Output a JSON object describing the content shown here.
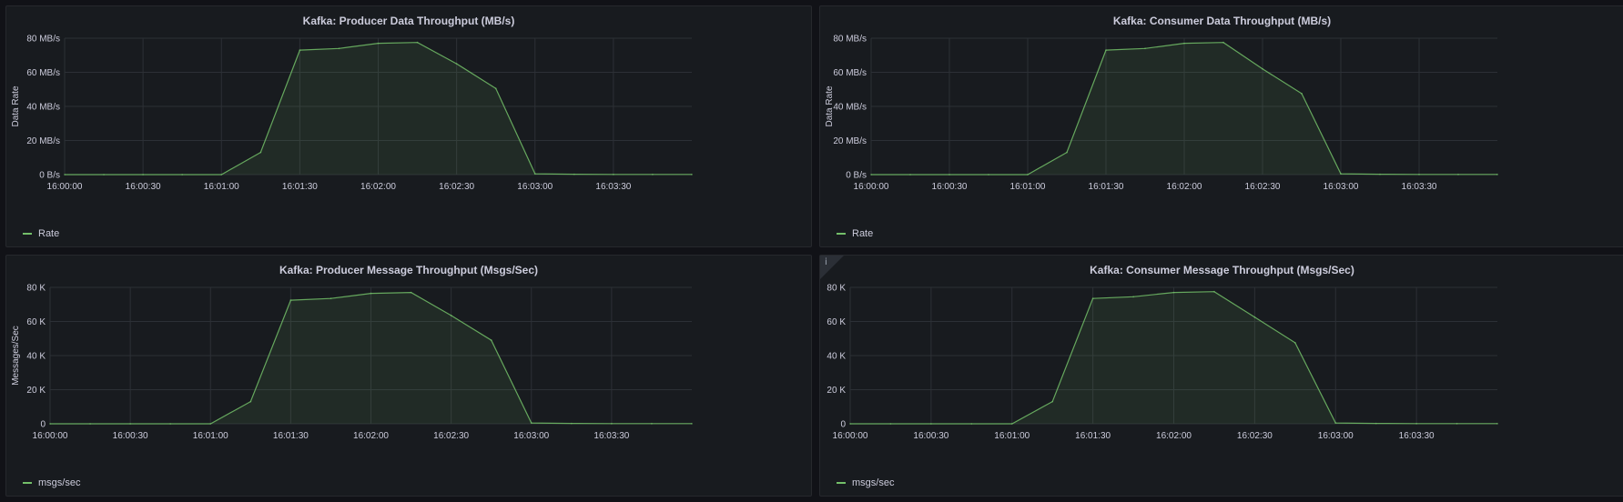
{
  "theme": {
    "background": "#111217",
    "panel_background": "#181b1f",
    "grid_color": "#2c3036",
    "series_color": "#73bf69",
    "text_color": "#ccccdc"
  },
  "chart_data": [
    {
      "type": "area",
      "title": "Kafka: Producer Data Throughput (MB/s)",
      "ylabel": "Data Rate",
      "xlabel": "",
      "x_ticks": [
        "16:00:00",
        "16:00:30",
        "16:01:00",
        "16:01:30",
        "16:02:00",
        "16:02:30",
        "16:03:00",
        "16:03:30"
      ],
      "y_ticks": [
        "0 B/s",
        "20 MB/s",
        "40 MB/s",
        "60 MB/s",
        "80 MB/s"
      ],
      "ylim": [
        0,
        80
      ],
      "xlim_seconds": [
        0,
        240
      ],
      "grid": true,
      "legend_position": "bottom-left",
      "series": [
        {
          "name": "Rate",
          "x": [
            0,
            15,
            30,
            45,
            60,
            75,
            90,
            105,
            120,
            135,
            150,
            165,
            180,
            195,
            210,
            225,
            240
          ],
          "values": [
            0,
            0,
            0,
            0,
            0,
            13,
            73,
            74,
            77,
            77.5,
            65,
            50.5,
            0.5,
            0.2,
            0.1,
            0.1,
            0.1
          ]
        }
      ]
    },
    {
      "type": "area",
      "title": "Kafka: Consumer Data Throughput (MB/s)",
      "ylabel": "Data Rate",
      "xlabel": "",
      "x_ticks": [
        "16:00:00",
        "16:00:30",
        "16:01:00",
        "16:01:30",
        "16:02:00",
        "16:02:30",
        "16:03:00",
        "16:03:30"
      ],
      "y_ticks": [
        "0 B/s",
        "20 MB/s",
        "40 MB/s",
        "60 MB/s",
        "80 MB/s"
      ],
      "ylim": [
        0,
        80
      ],
      "xlim_seconds": [
        0,
        240
      ],
      "grid": true,
      "legend_position": "bottom-left",
      "series": [
        {
          "name": "Rate",
          "x": [
            0,
            15,
            30,
            45,
            60,
            75,
            90,
            105,
            120,
            135,
            150,
            165,
            180,
            195,
            210,
            225,
            240
          ],
          "values": [
            0,
            0,
            0,
            0,
            0,
            13,
            73,
            74,
            77,
            77.5,
            62,
            47.5,
            0.5,
            0.2,
            0.1,
            0.1,
            0.1
          ]
        }
      ]
    },
    {
      "type": "area",
      "title": "Kafka: Producer Message Throughput (Msgs/Sec)",
      "ylabel": "Messages/Sec",
      "xlabel": "",
      "x_ticks": [
        "16:00:00",
        "16:00:30",
        "16:01:00",
        "16:01:30",
        "16:02:00",
        "16:02:30",
        "16:03:00",
        "16:03:30"
      ],
      "y_ticks": [
        "0",
        "20 K",
        "40 K",
        "60 K",
        "80 K"
      ],
      "ylim": [
        0,
        80000
      ],
      "xlim_seconds": [
        0,
        240
      ],
      "grid": true,
      "legend_position": "bottom-left",
      "series": [
        {
          "name": "msgs/sec",
          "x": [
            0,
            15,
            30,
            45,
            60,
            75,
            90,
            105,
            120,
            135,
            150,
            165,
            180,
            195,
            210,
            225,
            240
          ],
          "values": [
            0,
            0,
            0,
            0,
            0,
            13000,
            72500,
            73500,
            76500,
            77000,
            63500,
            49000,
            500,
            200,
            100,
            100,
            100
          ]
        }
      ]
    },
    {
      "type": "area",
      "title": "Kafka: Consumer Message Throughput (Msgs/Sec)",
      "ylabel": "",
      "xlabel": "",
      "x_ticks": [
        "16:00:00",
        "16:00:30",
        "16:01:00",
        "16:01:30",
        "16:02:00",
        "16:02:30",
        "16:03:00",
        "16:03:30"
      ],
      "y_ticks": [
        "0",
        "20 K",
        "40 K",
        "60 K",
        "80 K"
      ],
      "ylim": [
        0,
        80000
      ],
      "xlim_seconds": [
        0,
        240
      ],
      "grid": true,
      "legend_position": "bottom-left",
      "info_icon": "i",
      "series": [
        {
          "name": "msgs/sec",
          "x": [
            0,
            15,
            30,
            45,
            60,
            75,
            90,
            105,
            120,
            135,
            150,
            165,
            180,
            195,
            210,
            225,
            240
          ],
          "values": [
            0,
            0,
            0,
            0,
            0,
            13000,
            73500,
            74500,
            77000,
            77500,
            62500,
            47500,
            500,
            200,
            100,
            100,
            100
          ]
        }
      ]
    }
  ]
}
